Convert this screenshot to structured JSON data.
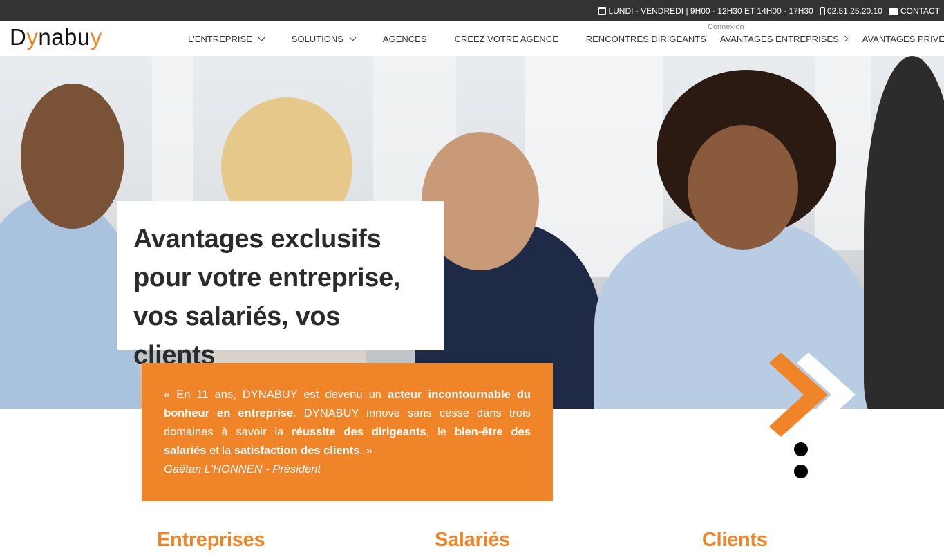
{
  "topbar": {
    "hours": "LUNDI - VENDREDI | 9H00 - 12H30 ET 14H00 - 17H30",
    "phone": "02.51.25.20.10",
    "contact": "CONTACT",
    "icons": [
      "calendar-icon",
      "mobile-phone-icon",
      "envelope-icon"
    ]
  },
  "navbar": {
    "logo_prefix": "D",
    "logo_y": "y",
    "logo_suffix": "nabu",
    "logo_end": "y",
    "connexion": "Connexion",
    "items": [
      {
        "label": "L'ENTREPRISE",
        "has_dropdown": true
      },
      {
        "label": "SOLUTIONS",
        "has_dropdown": true
      },
      {
        "label": "AGENCES",
        "has_dropdown": false
      },
      {
        "label": "CRÉEZ VOTRE AGENCE",
        "has_dropdown": false
      },
      {
        "label": "RENCONTRES DIRIGEANTS",
        "has_dropdown": false
      },
      {
        "label": "AVANTAGES ENTREPRISES",
        "has_arrow": true
      },
      {
        "label": "AVANTAGES PRIVÉS",
        "has_arrow": true
      }
    ]
  },
  "hero": {
    "headline_line1": "Avantages exclusifs",
    "headline_line2": "pour votre entreprise,",
    "headline_line3": "vos salariés, vos clients"
  },
  "quote": {
    "p1": "« En 11 ans, DYNABUY est devenu un ",
    "b1": "acteur incontournable du bonheur en entreprise",
    "p2": ". DYNABUY innove sans cesse dans trois domaines à savoir la ",
    "b2": "réussite des dirigeants",
    "p3": ", le ",
    "b3": "bien-être des salariés",
    "p4": " et la ",
    "b4": "satisfaction des clients",
    "p5": ". »",
    "author": "Gaëtan L'HONNEN - Président"
  },
  "pillars": {
    "entreprises": "Entreprises",
    "salaries": "Salariés",
    "clients": "Clients"
  },
  "colors": {
    "accent": "#ef8428",
    "topbar": "#333333",
    "text": "#2b2b2b"
  }
}
